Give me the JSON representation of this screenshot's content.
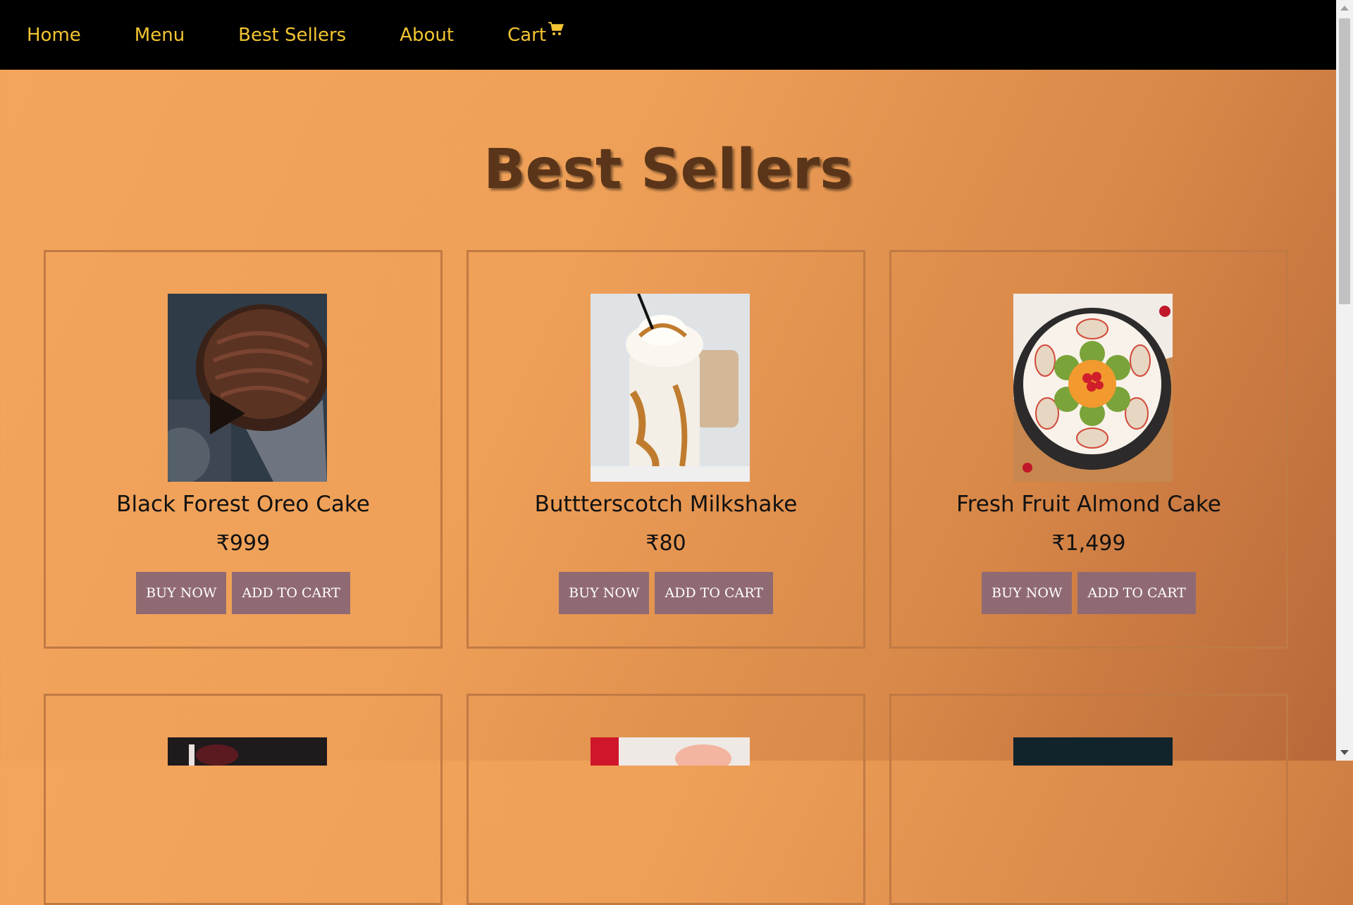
{
  "nav": {
    "home": "Home",
    "menu": "Menu",
    "best_sellers": "Best Sellers",
    "about": "About",
    "cart": "Cart",
    "cart_icon": "cart-icon",
    "link_color": "#f2c532"
  },
  "page": {
    "title": "Best Sellers"
  },
  "products": [
    {
      "name": "Black Forest Oreo Cake",
      "price": "₹999",
      "buy": "BUY NOW",
      "add": "ADD TO CART"
    },
    {
      "name": "Buttterscotch Milkshake",
      "price": "₹80",
      "buy": "BUY NOW",
      "add": "ADD TO CART"
    },
    {
      "name": "Fresh Fruit Almond Cake",
      "price": "₹1,499",
      "buy": "BUY NOW",
      "add": "ADD TO CART"
    }
  ],
  "colors": {
    "button_bg": "#906a73",
    "title": "#5a3519",
    "card_border": "#c07a44"
  }
}
